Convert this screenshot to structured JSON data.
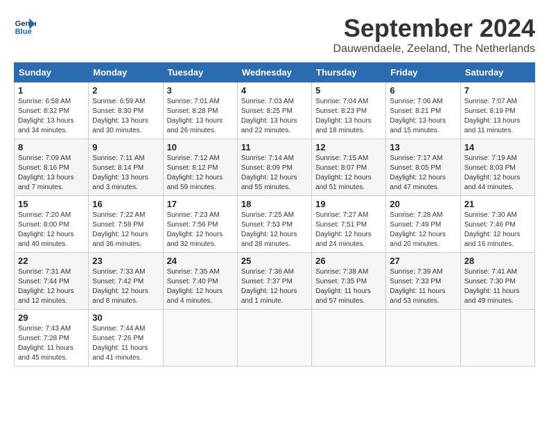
{
  "header": {
    "logo_line1": "General",
    "logo_line2": "Blue",
    "title": "September 2024",
    "subtitle": "Dauwendaele, Zeeland, The Netherlands"
  },
  "weekdays": [
    "Sunday",
    "Monday",
    "Tuesday",
    "Wednesday",
    "Thursday",
    "Friday",
    "Saturday"
  ],
  "weeks": [
    [
      {
        "day": "1",
        "sunrise": "6:58 AM",
        "sunset": "8:32 PM",
        "daylight": "13 hours and 34 minutes."
      },
      {
        "day": "2",
        "sunrise": "6:59 AM",
        "sunset": "8:30 PM",
        "daylight": "13 hours and 30 minutes."
      },
      {
        "day": "3",
        "sunrise": "7:01 AM",
        "sunset": "8:28 PM",
        "daylight": "13 hours and 26 minutes."
      },
      {
        "day": "4",
        "sunrise": "7:03 AM",
        "sunset": "8:25 PM",
        "daylight": "13 hours and 22 minutes."
      },
      {
        "day": "5",
        "sunrise": "7:04 AM",
        "sunset": "8:23 PM",
        "daylight": "13 hours and 18 minutes."
      },
      {
        "day": "6",
        "sunrise": "7:06 AM",
        "sunset": "8:21 PM",
        "daylight": "13 hours and 15 minutes."
      },
      {
        "day": "7",
        "sunrise": "7:07 AM",
        "sunset": "8:19 PM",
        "daylight": "13 hours and 11 minutes."
      }
    ],
    [
      {
        "day": "8",
        "sunrise": "7:09 AM",
        "sunset": "8:16 PM",
        "daylight": "13 hours and 7 minutes."
      },
      {
        "day": "9",
        "sunrise": "7:11 AM",
        "sunset": "8:14 PM",
        "daylight": "13 hours and 3 minutes."
      },
      {
        "day": "10",
        "sunrise": "7:12 AM",
        "sunset": "8:12 PM",
        "daylight": "12 hours and 59 minutes."
      },
      {
        "day": "11",
        "sunrise": "7:14 AM",
        "sunset": "8:09 PM",
        "daylight": "12 hours and 55 minutes."
      },
      {
        "day": "12",
        "sunrise": "7:15 AM",
        "sunset": "8:07 PM",
        "daylight": "12 hours and 51 minutes."
      },
      {
        "day": "13",
        "sunrise": "7:17 AM",
        "sunset": "8:05 PM",
        "daylight": "12 hours and 47 minutes."
      },
      {
        "day": "14",
        "sunrise": "7:19 AM",
        "sunset": "8:03 PM",
        "daylight": "12 hours and 44 minutes."
      }
    ],
    [
      {
        "day": "15",
        "sunrise": "7:20 AM",
        "sunset": "8:00 PM",
        "daylight": "12 hours and 40 minutes."
      },
      {
        "day": "16",
        "sunrise": "7:22 AM",
        "sunset": "7:58 PM",
        "daylight": "12 hours and 36 minutes."
      },
      {
        "day": "17",
        "sunrise": "7:23 AM",
        "sunset": "7:56 PM",
        "daylight": "12 hours and 32 minutes."
      },
      {
        "day": "18",
        "sunrise": "7:25 AM",
        "sunset": "7:53 PM",
        "daylight": "12 hours and 28 minutes."
      },
      {
        "day": "19",
        "sunrise": "7:27 AM",
        "sunset": "7:51 PM",
        "daylight": "12 hours and 24 minutes."
      },
      {
        "day": "20",
        "sunrise": "7:28 AM",
        "sunset": "7:49 PM",
        "daylight": "12 hours and 20 minutes."
      },
      {
        "day": "21",
        "sunrise": "7:30 AM",
        "sunset": "7:46 PM",
        "daylight": "12 hours and 16 minutes."
      }
    ],
    [
      {
        "day": "22",
        "sunrise": "7:31 AM",
        "sunset": "7:44 PM",
        "daylight": "12 hours and 12 minutes."
      },
      {
        "day": "23",
        "sunrise": "7:33 AM",
        "sunset": "7:42 PM",
        "daylight": "12 hours and 8 minutes."
      },
      {
        "day": "24",
        "sunrise": "7:35 AM",
        "sunset": "7:40 PM",
        "daylight": "12 hours and 4 minutes."
      },
      {
        "day": "25",
        "sunrise": "7:36 AM",
        "sunset": "7:37 PM",
        "daylight": "12 hours and 1 minute."
      },
      {
        "day": "26",
        "sunrise": "7:38 AM",
        "sunset": "7:35 PM",
        "daylight": "11 hours and 57 minutes."
      },
      {
        "day": "27",
        "sunrise": "7:39 AM",
        "sunset": "7:33 PM",
        "daylight": "11 hours and 53 minutes."
      },
      {
        "day": "28",
        "sunrise": "7:41 AM",
        "sunset": "7:30 PM",
        "daylight": "11 hours and 49 minutes."
      }
    ],
    [
      {
        "day": "29",
        "sunrise": "7:43 AM",
        "sunset": "7:28 PM",
        "daylight": "11 hours and 45 minutes."
      },
      {
        "day": "30",
        "sunrise": "7:44 AM",
        "sunset": "7:26 PM",
        "daylight": "11 hours and 41 minutes."
      },
      null,
      null,
      null,
      null,
      null
    ]
  ]
}
